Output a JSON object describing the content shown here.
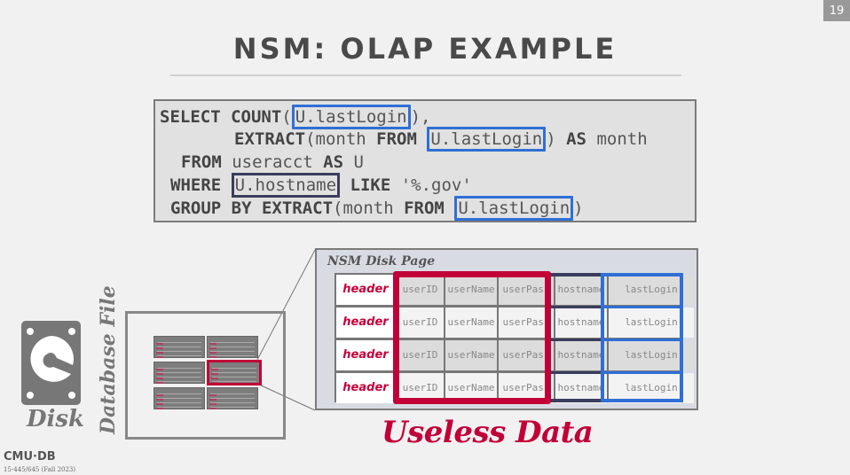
{
  "slide": {
    "number": "19",
    "title": "NSM: OLAP EXAMPLE"
  },
  "sql": {
    "line1": {
      "kw1": "SELECT",
      "kw2": "COUNT",
      "open": "(",
      "col": "U.lastLogin",
      "close": "),"
    },
    "line2": {
      "kw1": "EXTRACT",
      "t1": "(month ",
      "kw2": "FROM",
      "col": "U.lastLogin",
      "t2": ") ",
      "kw3": "AS",
      "t3": " month"
    },
    "line3": {
      "kw1": "FROM",
      "t1": " useracct ",
      "kw2": "AS",
      "t2": " U"
    },
    "line4": {
      "kw1": "WHERE",
      "col": "U.hostname",
      "kw2": "LIKE",
      "t1": " '%.gov'"
    },
    "line5": {
      "kw1": "GROUP BY EXTRACT",
      "t1": "(month ",
      "kw2": "FROM",
      "col": "U.lastLogin",
      "t2": ")"
    }
  },
  "disk_page": {
    "label": "NSM Disk Page",
    "header_label": "header",
    "columns": [
      "userID",
      "userName",
      "userPass",
      "hostname",
      "lastLogin"
    ],
    "rows": 4
  },
  "useless_label": "Useless Data",
  "disk_label": "Disk",
  "database_file_label": "Database File",
  "footer": {
    "logo": "CMU·DB",
    "course": "15-445/645 (Fall 2023)"
  },
  "colors": {
    "accent_red": "#c20038",
    "accent_blue": "#2f6fd6",
    "accent_dark": "#3a3d5c"
  }
}
